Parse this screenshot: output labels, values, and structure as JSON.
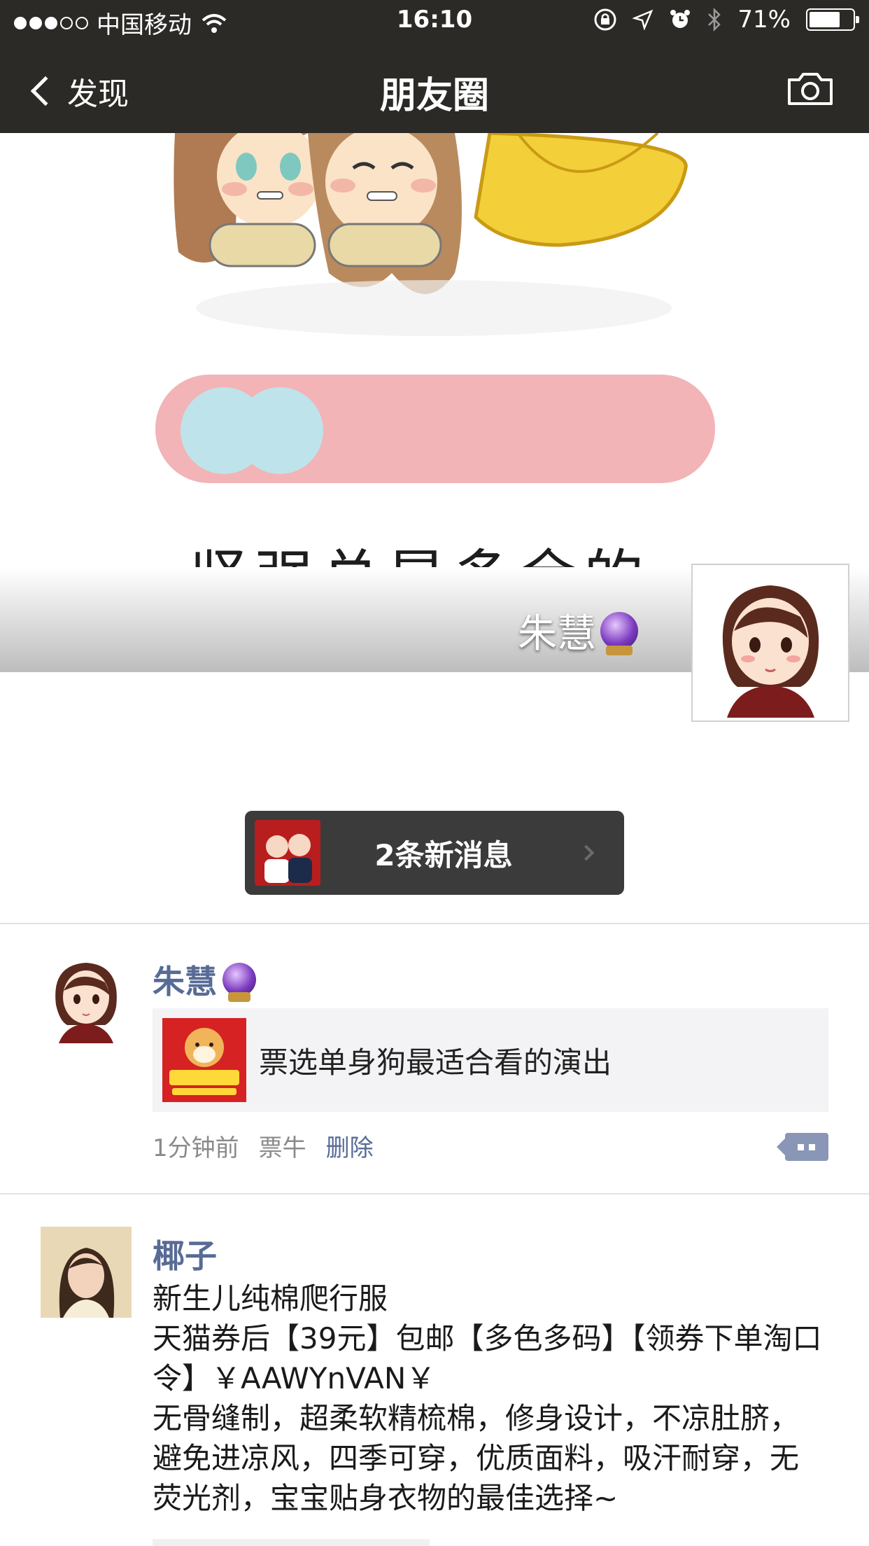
{
  "status_bar": {
    "carrier": "中国移动",
    "time": "16:10",
    "battery_percent": "71%",
    "battery_level": 0.71,
    "icons": [
      "signal-dots-icon",
      "wifi-icon",
      "rotation-lock-icon",
      "location-icon",
      "alarm-icon",
      "bluetooth-icon",
      "battery-icon"
    ]
  },
  "nav": {
    "back_label": "发现",
    "title": "朋友圈",
    "right_icon": "camera-icon"
  },
  "cover": {
    "banner_text": "坚强总是多余的。",
    "user_name": "朱慧"
  },
  "new_messages": {
    "label": "2条新消息"
  },
  "posts": [
    {
      "author": "朱慧",
      "link_title": "票选单身狗最适合看的演出",
      "time": "1分钟前",
      "source": "票牛",
      "delete_label": "删除"
    },
    {
      "author": "椰子",
      "lines": [
        "新生儿纯棉爬行服",
        "天猫券后【39元】包邮【多色多码】【领券下单淘口令】￥AAWYnVAN￥",
        "无骨缝制，超柔软精梳棉，修身设计，不凉肚脐，避免进凉风，四季可穿，优质面料，吸汗耐穿，无荧光剂，宝宝贴身衣物的最佳选择~"
      ]
    }
  ],
  "colors": {
    "nav_bg": "#2b2a26",
    "link_blue": "#576b95",
    "pill_bg": "#3b3b3b",
    "banner_pink": "#f2b4b6",
    "banner_blue": "#bfe3ea"
  }
}
